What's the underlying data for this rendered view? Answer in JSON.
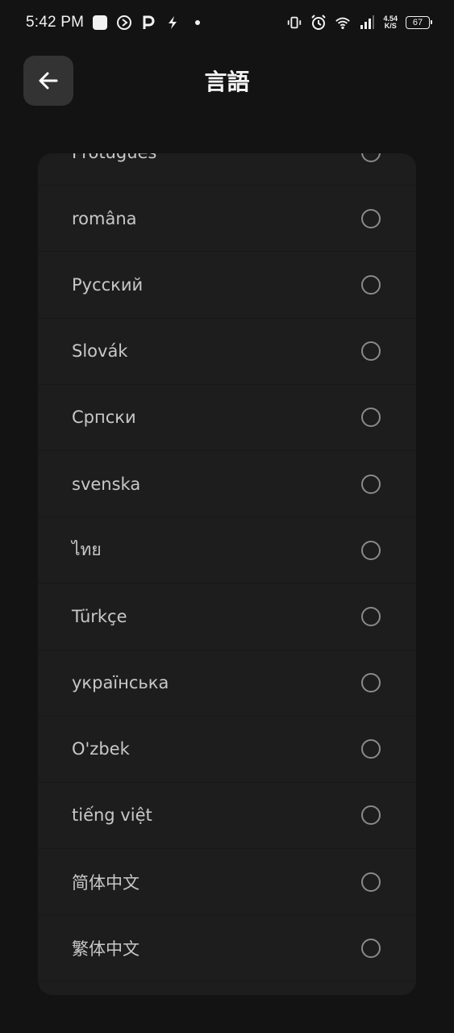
{
  "status_bar": {
    "time": "5:42 PM",
    "net_speed_value": "4.54",
    "net_speed_unit": "K/S",
    "battery_level": "67"
  },
  "header": {
    "title": "言語",
    "back_icon": "arrow-left-icon"
  },
  "languages": [
    {
      "label": "Protuguês",
      "selected": false
    },
    {
      "label": "româna",
      "selected": false
    },
    {
      "label": "Русский",
      "selected": false
    },
    {
      "label": "Slovák",
      "selected": false
    },
    {
      "label": "Српски",
      "selected": false
    },
    {
      "label": "svenska",
      "selected": false
    },
    {
      "label": "ไทย",
      "selected": false
    },
    {
      "label": "Türkçe",
      "selected": false
    },
    {
      "label": "українська",
      "selected": false
    },
    {
      "label": "O'zbek",
      "selected": false
    },
    {
      "label": "tiếng việt",
      "selected": false
    },
    {
      "label": "简体中文",
      "selected": false
    },
    {
      "label": "繁体中文",
      "selected": false
    }
  ],
  "colors": {
    "background": "#131313",
    "card": "#1d1d1d",
    "back_button": "#333333",
    "text": "#c8c8c8",
    "radio_border": "#8a8a8a"
  }
}
